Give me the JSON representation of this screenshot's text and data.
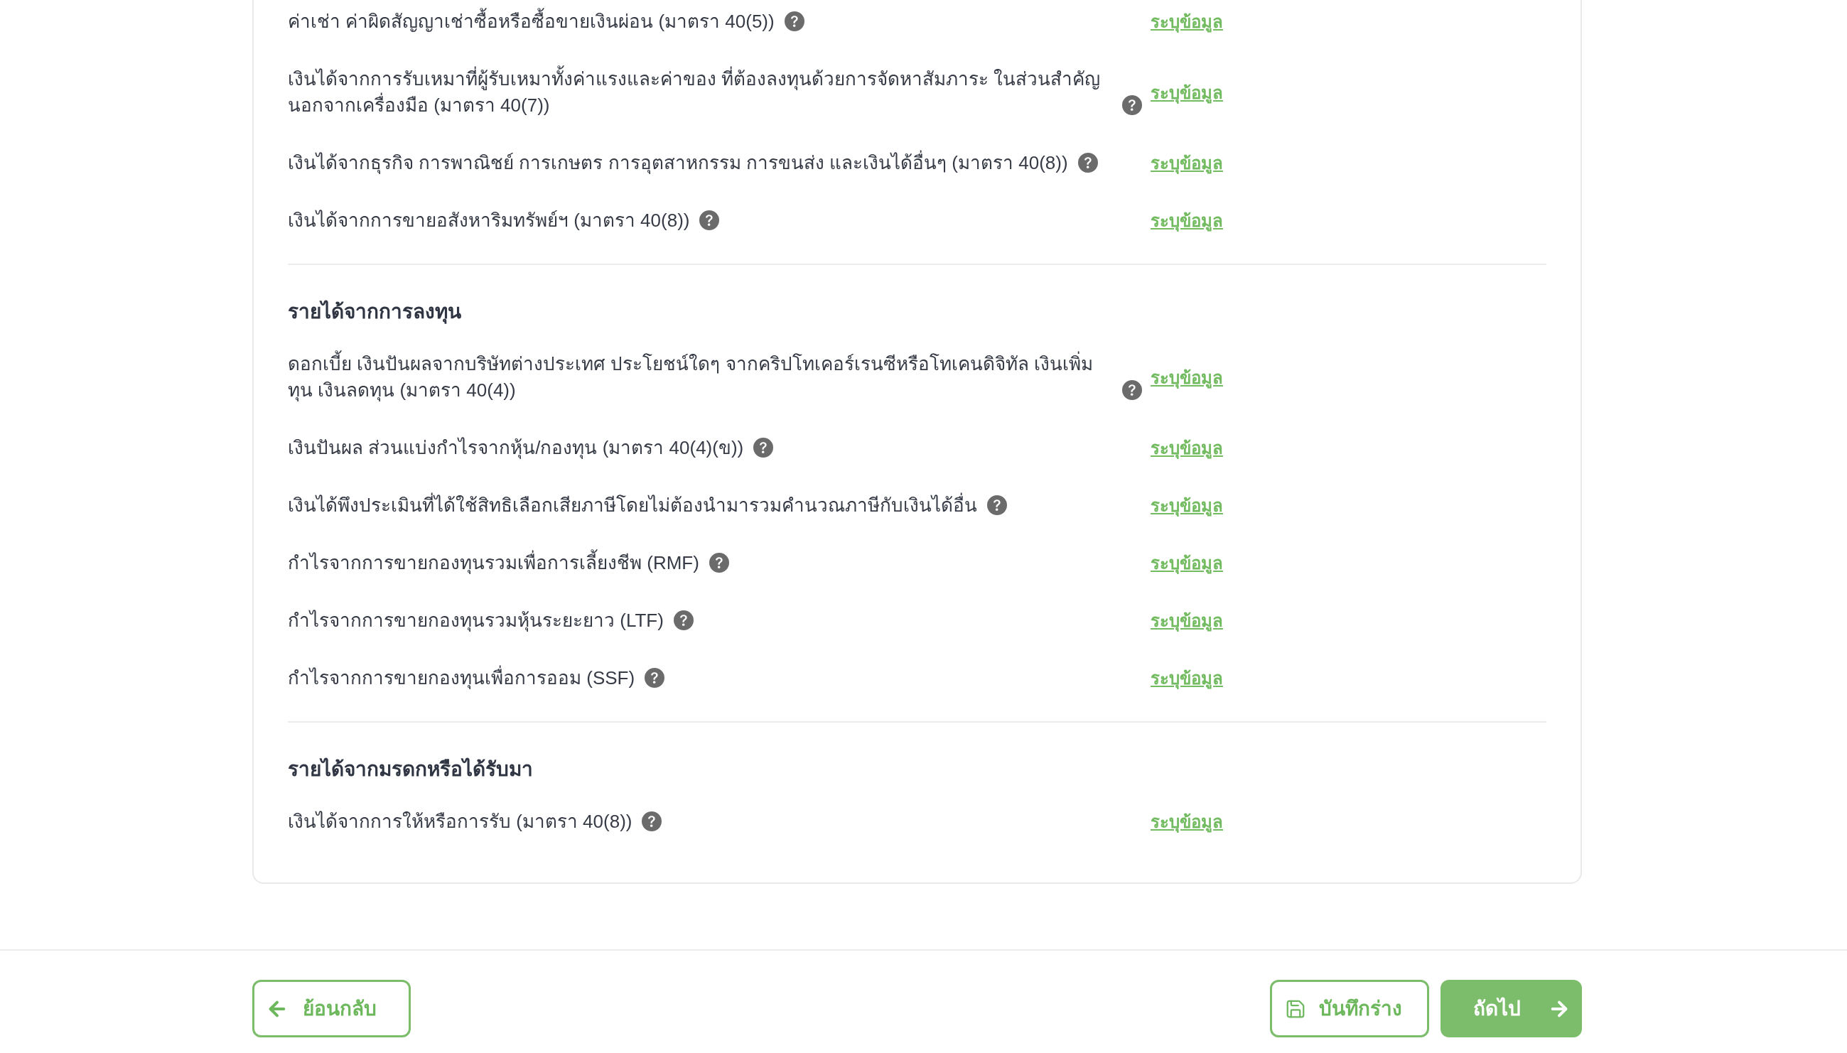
{
  "sections": [
    {
      "items": [
        {
          "label": "ค่าเช่า ค่าผิดสัญญาเช่าซื้อหรือซื้อขายเงินผ่อน (มาตรา 40(5))",
          "link": "ระบุข้อมูล"
        },
        {
          "label": "เงินได้จากการรับเหมาที่ผู้รับเหมาทั้งค่าแรงและค่าของ ที่ต้องลงทุนด้วยการจัดหาสัมภาระ ในส่วนสำคัญนอกจากเครื่องมือ (มาตรา 40(7))",
          "link": "ระบุข้อมูล"
        },
        {
          "label": "เงินได้จากธุรกิจ การพาณิชย์ การเกษตร การอุตสาหกรรม การขนส่ง และเงินได้อื่นๆ (มาตรา 40(8))",
          "link": "ระบุข้อมูล"
        },
        {
          "label": "เงินได้จากการขายอสังหาริมทรัพย์ฯ (มาตรา 40(8))",
          "link": "ระบุข้อมูล"
        }
      ]
    },
    {
      "heading": "รายได้จากการลงทุน",
      "items": [
        {
          "label": "ดอกเบี้ย เงินปันผลจากบริษัทต่างประเทศ ประโยชน์ใดๆ จากคริปโทเคอร์เรนซีหรือโทเคนดิจิทัล เงินเพิ่มทุน เงินลดทุน (มาตรา 40(4))",
          "link": "ระบุข้อมูล"
        },
        {
          "label": "เงินปันผล ส่วนแบ่งกำไรจากหุ้น/กองทุน (มาตรา 40(4)(ข))",
          "link": "ระบุข้อมูล"
        },
        {
          "label": "เงินได้พึงประเมินที่ได้ใช้สิทธิเลือกเสียภาษีโดยไม่ต้องนำมารวมคำนวณภาษีกับเงินได้อื่น",
          "link": "ระบุข้อมูล"
        },
        {
          "label": "กำไรจากการขายกองทุนรวมเพื่อการเลี้ยงชีพ (RMF)",
          "link": "ระบุข้อมูล"
        },
        {
          "label": "กำไรจากการขายกองทุนรวมหุ้นระยะยาว (LTF)",
          "link": "ระบุข้อมูล"
        },
        {
          "label": "กำไรจากการขายกองทุนเพื่อการออม (SSF)",
          "link": "ระบุข้อมูล"
        }
      ]
    },
    {
      "heading": "รายได้จากมรดกหรือได้รับมา",
      "items": [
        {
          "label": "เงินได้จากการให้หรือการรับ (มาตรา 40(8))",
          "link": "ระบุข้อมูล"
        }
      ]
    }
  ],
  "footer": {
    "back_button": "ย้อนกลับ",
    "save_draft_button": "บันทึกร่าง",
    "next_button": "ถัดไป"
  }
}
